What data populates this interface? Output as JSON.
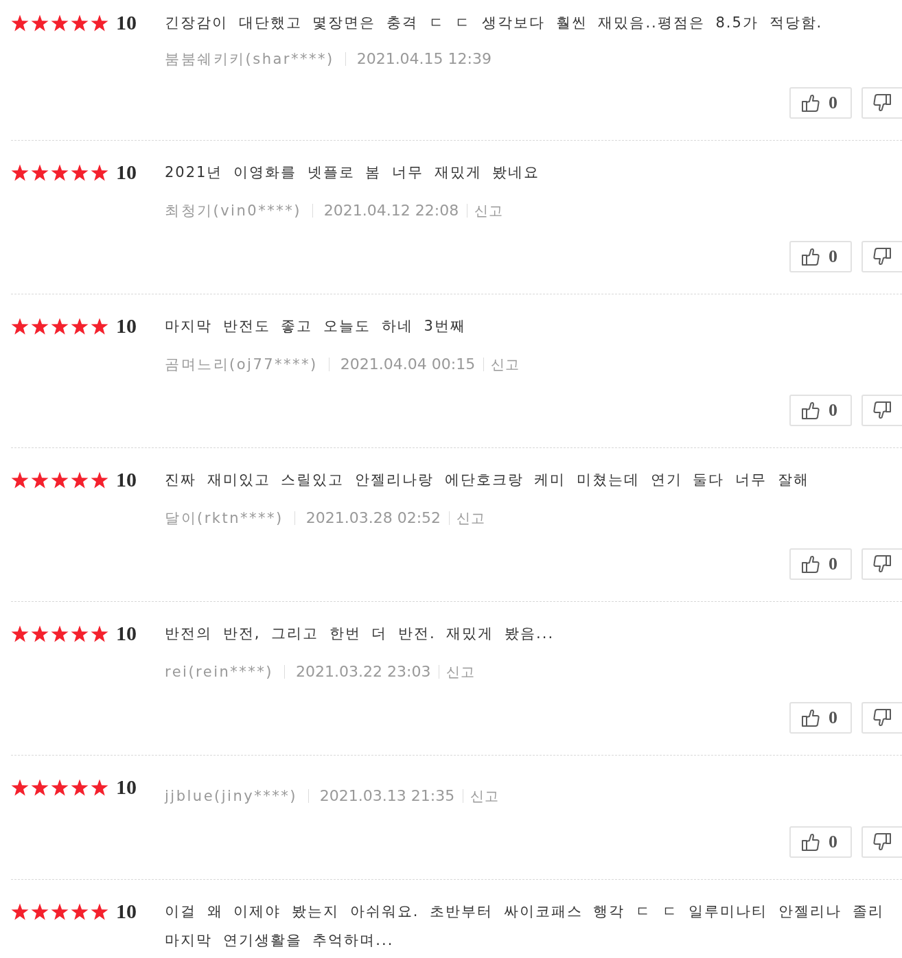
{
  "reviews": [
    {
      "stars": 5,
      "score": "10",
      "comment": "긴장감이 대단했고 몇장면은 충격 ㄷ ㄷ 생각보다 훨씬 재밌음..평점은 8.5가 적당함.",
      "author": "붐붐쉐키키(shar****)",
      "date": "2021.04.15 12:39",
      "likes": "0"
    },
    {
      "stars": 5,
      "score": "10",
      "comment": "2021년 이영화를 넷플로 봄 너무 재밌게 봤네요",
      "author": "최청기(vin0****)",
      "date": "2021.04.12 22:08",
      "report": "신고",
      "likes": "0"
    },
    {
      "stars": 5,
      "score": "10",
      "comment": "마지막 반전도 좋고 오늘도 하네 3번째",
      "author": "곰며느리(oj77****)",
      "date": "2021.04.04 00:15",
      "report": "신고",
      "likes": "0"
    },
    {
      "stars": 5,
      "score": "10",
      "comment": "진짜 재미있고 스릴있고 안젤리나랑 에단호크랑 케미 미쳤는데 연기 둘다 너무 잘해",
      "author": "달이(rktn****)",
      "date": "2021.03.28 02:52",
      "report": "신고",
      "likes": "0"
    },
    {
      "stars": 5,
      "score": "10",
      "comment": "반전의 반전, 그리고 한번 더 반전. 재밌게 봤음...",
      "author": "rei(rein****)",
      "date": "2021.03.22 23:03",
      "report": "신고",
      "likes": "0"
    },
    {
      "stars": 5,
      "score": "10",
      "author": "jjblue(jiny****)",
      "date": "2021.03.13 21:35",
      "report": "신고",
      "likes": "0"
    },
    {
      "stars": 5,
      "score": "10",
      "comment": "이걸 왜 이제야 봤는지 아쉬워요. 초반부터 싸이코패스 행각 ㄷ ㄷ 일루미나티 안젤리나 졸리 마지막 연기생활을 추억하며..."
    }
  ]
}
